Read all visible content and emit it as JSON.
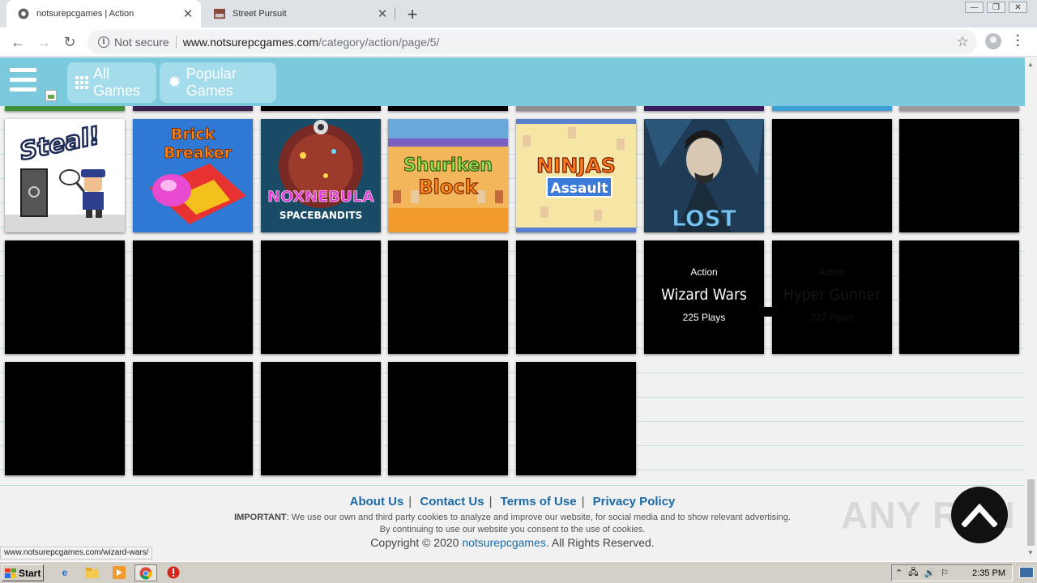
{
  "browser": {
    "tabs": [
      {
        "title": "notsurepcgames | Action",
        "active": true
      },
      {
        "title": "Street Pursuit",
        "active": false
      }
    ],
    "new_tab": "+",
    "security_label": "Not secure",
    "url_domain": "www.notsurepcgames.com",
    "url_path": "/category/action/page/5/"
  },
  "header": {
    "all_games_label": "All Games",
    "popular_games_label": "Popular Games"
  },
  "grid": {
    "hover_tiles": [
      {
        "category": "Action",
        "name": "Wizard Wars",
        "plays": "225 Plays"
      },
      {
        "category": "Action",
        "name": "Hyper Gunner",
        "plays": "227 Plays"
      }
    ],
    "thumbnails": [
      {
        "name": "steal-thumbnail",
        "text": "Steal!"
      },
      {
        "name": "brick-breaker-thumbnail",
        "text_1": "Brick",
        "text_2": "Breaker"
      },
      {
        "name": "noxnebula-thumbnail",
        "text_1": "NOXNEBULA",
        "text_2": "SPACEBANDITS"
      },
      {
        "name": "shuriken-block-thumbnail",
        "text_1": "Shuriken",
        "text_2": "Block"
      },
      {
        "name": "ninjas-assault-thumbnail",
        "text_1": "NINJAS",
        "text_2": "Assault"
      },
      {
        "name": "lost-thumbnail",
        "text": "LOST"
      }
    ]
  },
  "footer": {
    "links": [
      "About Us",
      "Contact Us",
      "Terms of Use",
      "Privacy Policy"
    ],
    "notice_label": "IMPORTANT",
    "notice_line1": ": We use our own and third party cookies to analyze and improve our website, for social media and to show relevant advertising.",
    "notice_line2": "By continuing to use our website you consent to the use of cookies.",
    "copyright_prefix": "Copyright © 2020 ",
    "copyright_site": "notsurepcgames",
    "copyright_suffix": ". All Rights Reserved."
  },
  "watermark": "ANY RUN",
  "status_url": "www.notsurepcgames.com/wizard-wars/",
  "taskbar": {
    "start_label": "Start",
    "clock": "2:35 PM"
  },
  "colors": {
    "header": "#7ac9dc",
    "header_button": "#a4dceb",
    "link": "#1b6aa6"
  }
}
